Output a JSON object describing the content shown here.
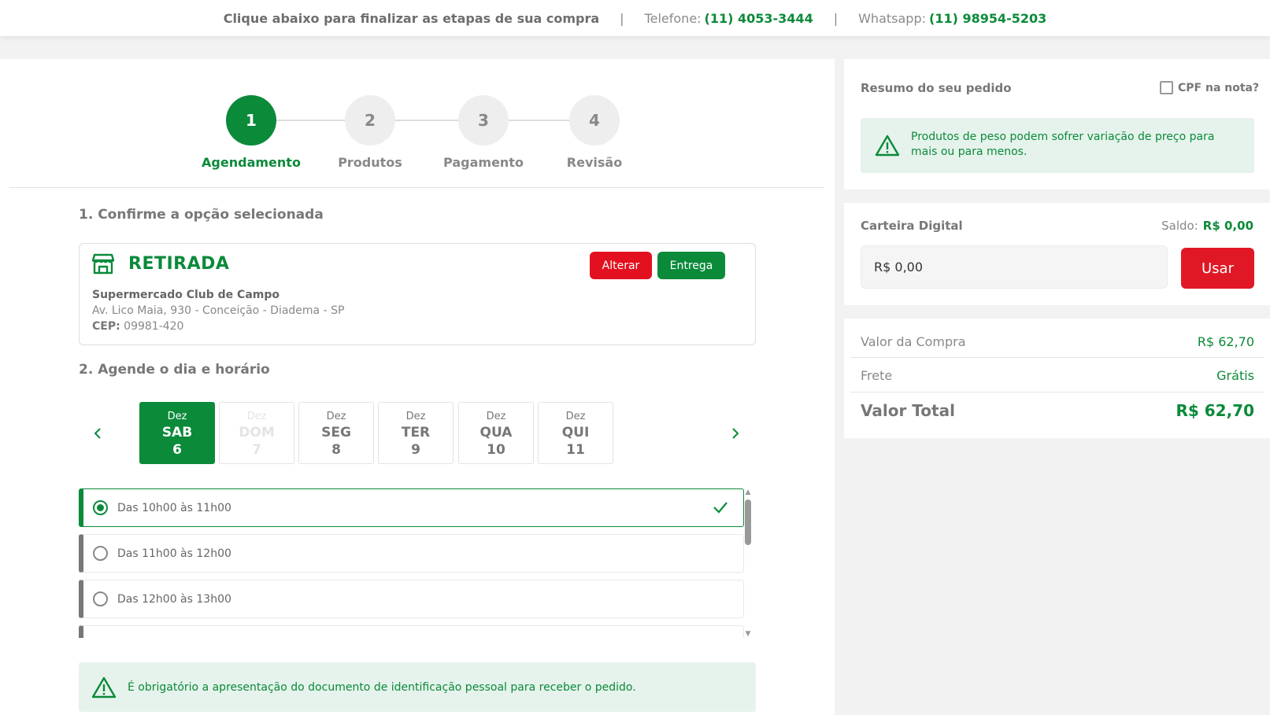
{
  "topbar": {
    "message": "Clique abaixo para finalizar as etapas de sua compra",
    "separator": "|",
    "phone_label": "Telefone:",
    "phone_number": "(11) 4053-3444",
    "whatsapp_label": "Whatsapp:",
    "whatsapp_number": "(11) 98954-5203"
  },
  "stepper": {
    "steps": [
      {
        "number": "1",
        "label": "Agendamento",
        "active": true
      },
      {
        "number": "2",
        "label": "Produtos",
        "active": false
      },
      {
        "number": "3",
        "label": "Pagamento",
        "active": false
      },
      {
        "number": "4",
        "label": "Revisão",
        "active": false
      }
    ]
  },
  "section1": {
    "title": "1. Confirme a opção selecionada",
    "option_title": "RETIRADA",
    "change_button": "Alterar",
    "delivery_button": "Entrega",
    "store_name": "Supermercado Club de Campo",
    "store_address": "Av. Lico Maia, 930 - Conceição - Diadema - SP",
    "cep_label": "CEP:",
    "cep_value": "09981-420"
  },
  "section2": {
    "title": "2. Agende o dia e horário",
    "days": [
      {
        "month": "Dez",
        "weekday": "SAB",
        "day": "6",
        "state": "selected"
      },
      {
        "month": "Dez",
        "weekday": "DOM",
        "day": "7",
        "state": "disabled"
      },
      {
        "month": "Dez",
        "weekday": "SEG",
        "day": "8",
        "state": "normal"
      },
      {
        "month": "Dez",
        "weekday": "TER",
        "day": "9",
        "state": "normal"
      },
      {
        "month": "Dez",
        "weekday": "QUA",
        "day": "10",
        "state": "normal"
      },
      {
        "month": "Dez",
        "weekday": "QUI",
        "day": "11",
        "state": "normal"
      }
    ],
    "slots": [
      {
        "label": "Das 10h00 às 11h00",
        "selected": true
      },
      {
        "label": "Das 11h00 às 12h00",
        "selected": false
      },
      {
        "label": "Das 12h00 às 13h00",
        "selected": false
      }
    ]
  },
  "notice_bottom": "É obrigatório a apresentação do documento de identificação pessoal para receber o pedido.",
  "summary": {
    "title": "Resumo do seu pedido",
    "cpf_label": "CPF na nota?",
    "alert": "Produtos de peso podem sofrer variação de preço para mais ou para menos."
  },
  "wallet": {
    "title": "Carteira Digital",
    "balance_label": "Saldo:",
    "balance_value": "R$ 0,00",
    "input_value": "R$ 0,00",
    "use_button": "Usar"
  },
  "totals": {
    "purchase_label": "Valor da Compra",
    "purchase_value": "R$ 62,70",
    "shipping_label": "Frete",
    "shipping_value": "Grátis",
    "total_label": "Valor Total",
    "total_value": "R$ 62,70"
  },
  "colors": {
    "brand_green": "#0b8a3a",
    "alert_red": "#e3101f",
    "notice_bg": "#e6f3ec"
  }
}
